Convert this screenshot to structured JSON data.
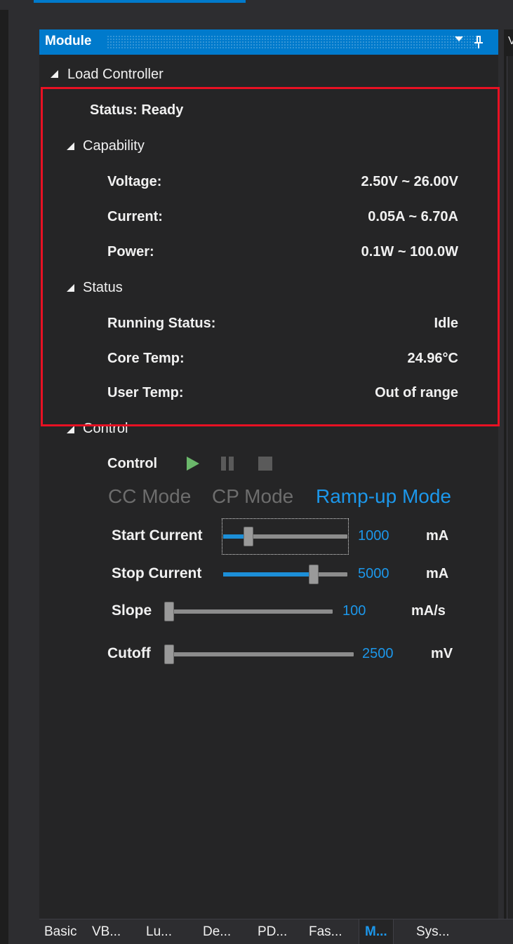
{
  "panel": {
    "title": "Module",
    "side_title": "V"
  },
  "tree": {
    "root": "Load Controller",
    "status_line": "Status: Ready",
    "capability": {
      "heading": "Capability",
      "rows": [
        {
          "label": "Voltage:",
          "value": "2.50V ~ 26.00V"
        },
        {
          "label": "Current:",
          "value": "0.05A ~ 6.70A"
        },
        {
          "label": "Power:",
          "value": "0.1W ~ 100.0W"
        }
      ]
    },
    "status": {
      "heading": "Status",
      "rows": [
        {
          "label": "Running Status:",
          "value": "Idle"
        },
        {
          "label": "Core Temp:",
          "value": "24.96°C"
        },
        {
          "label": "User Temp:",
          "value": "Out of range"
        }
      ]
    },
    "control": {
      "heading": "Control",
      "control_label": "Control",
      "modes": [
        "CC Mode",
        "CP Mode",
        "Ramp-up Mode"
      ],
      "active_mode": "Ramp-up Mode",
      "sliders": [
        {
          "label": "Start Current",
          "value": "1000",
          "unit": "mA",
          "fraction": 0.18
        },
        {
          "label": "Stop Current",
          "value": "5000",
          "unit": "mA",
          "fraction": 0.75
        },
        {
          "label": "Slope",
          "value": "100",
          "unit": "mA/s",
          "fraction": 0.0
        },
        {
          "label": "Cutoff",
          "value": "2500",
          "unit": "mV",
          "fraction": 0.0
        }
      ]
    }
  },
  "tabs": [
    "Basic",
    "VB...",
    "Lu...",
    "De...",
    "PD...",
    "Fas...",
    "M...",
    "Sys..."
  ],
  "active_tab": "M...",
  "colors": {
    "accent": "#007acc",
    "highlight_box": "#e81123",
    "active_mode": "#1c97ea",
    "play": "#6bb86b"
  }
}
